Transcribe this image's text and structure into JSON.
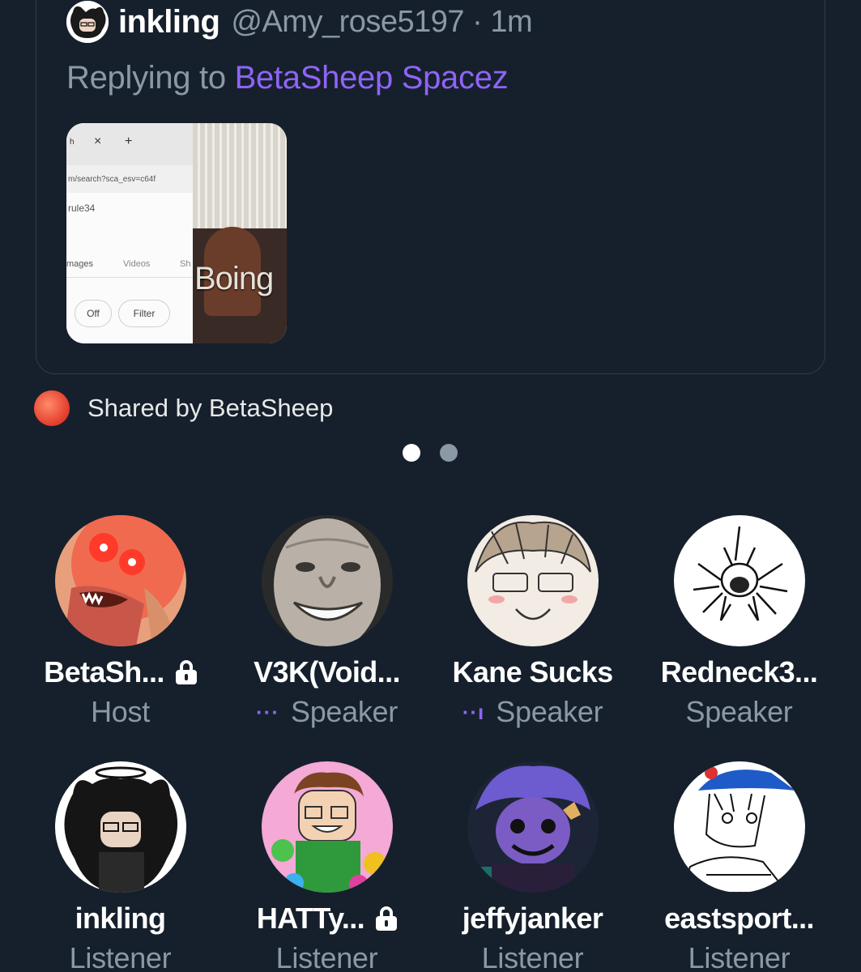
{
  "shared_tweet": {
    "author_name": "inkling",
    "author_handle_time": "@Amy_rose5197 · 1m",
    "reply_prefix": "Replying to",
    "reply_mention": "BetaSheep Spacez",
    "media": {
      "tab_close": "×",
      "tab_new": "+",
      "tab_fragment": "h",
      "url_text": "m/search?sca_esv=c64f",
      "query_text": "rule34",
      "tab_images": "mages",
      "tab_videos": "Videos",
      "tab_short": "Sh",
      "pill_off": "Off",
      "pill_filter": "Filter",
      "overlay_text": "Boing"
    }
  },
  "shared_by": {
    "label": "Shared by BetaSheep"
  },
  "pagination": {
    "count": 2,
    "active_index": 0
  },
  "participants": [
    {
      "name": "BetaSh...",
      "role": "Host",
      "locked": true,
      "speaking": false,
      "avatar": "red-creature-avatar"
    },
    {
      "name": "V3K(Void...",
      "role": "Speaker",
      "locked": false,
      "speaking": true,
      "speaking_glyph": "···",
      "avatar": "smiling-man-avatar"
    },
    {
      "name": "Kane Sucks",
      "role": "Speaker",
      "locked": false,
      "speaking": true,
      "speaking_glyph": "··ı",
      "avatar": "sketch-face-avatar"
    },
    {
      "name": "Redneck3...",
      "role": "Speaker",
      "locked": false,
      "speaking": false,
      "avatar": "screaming-doodle-avatar"
    },
    {
      "name": "inkling",
      "role": "Listener",
      "locked": false,
      "speaking": false,
      "avatar": "ink-demon-avatar"
    },
    {
      "name": "HATTy...",
      "role": "Listener",
      "locked": true,
      "speaking": false,
      "avatar": "cartoon-boy-avatar"
    },
    {
      "name": "jeffyjanker",
      "role": "Listener",
      "locked": false,
      "speaking": false,
      "avatar": "purple-creature-avatar"
    },
    {
      "name": "eastsport...",
      "role": "Listener",
      "locked": false,
      "speaking": false,
      "avatar": "manga-cap-avatar"
    }
  ]
}
